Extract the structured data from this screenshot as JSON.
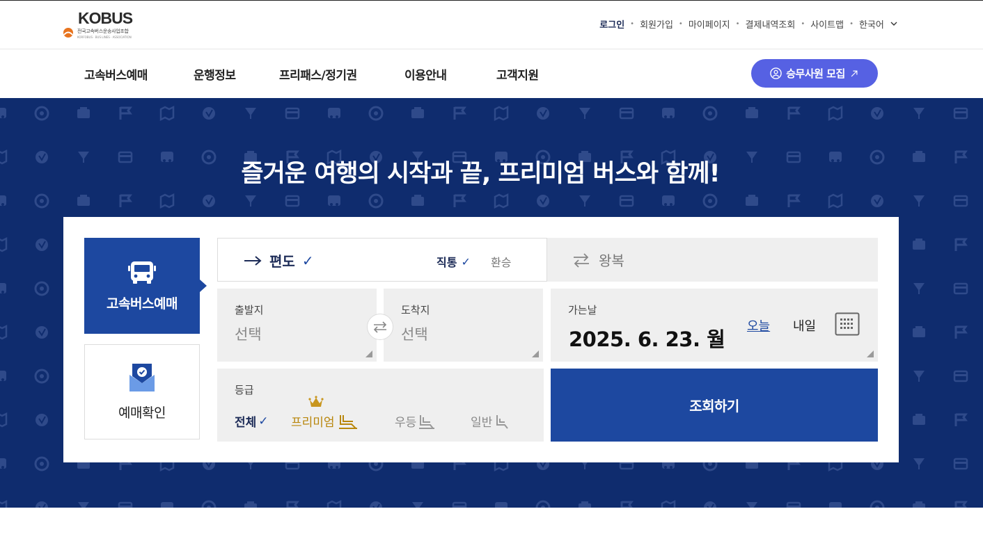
{
  "brand": {
    "logo_word": "KOBUS",
    "logo_sub": "전국고속버스운송사업조합",
    "logo_sub_en": "KORFOBUS · BUS LINES · ASSOCIATION",
    "accent_color": "#e8741f"
  },
  "util_nav": {
    "login": "로그인",
    "signup": "회원가입",
    "mypage": "마이페이지",
    "payments": "결제내역조회",
    "sitemap": "사이트맵",
    "language": "한국어"
  },
  "main_nav": {
    "items": [
      "고속버스예매",
      "운행정보",
      "프리패스/정기권",
      "이용안내",
      "고객지원"
    ],
    "recruit_button": "승무사원 모집",
    "recruit_color": "#5661e3"
  },
  "hero": {
    "title": "즐거운 여행의 시작과 끝, 프리미엄 버스와 함께!",
    "background": "#0f2c6e"
  },
  "booking": {
    "side_tabs": {
      "active": "고속버스예매",
      "inactive": "예매확인"
    },
    "trip_type": {
      "oneway": "편도",
      "direct": "직통",
      "transfer": "환승",
      "roundtrip": "왕복"
    },
    "depart": {
      "label": "출발지",
      "value": "선택"
    },
    "arrive": {
      "label": "도착지",
      "value": "선택"
    },
    "date": {
      "label": "가는날",
      "value": "2025. 6. 23. 월",
      "today": "오늘",
      "tomorrow": "내일"
    },
    "grade": {
      "label": "등급",
      "all": "전체",
      "premium": "프리미엄",
      "deluxe": "우등",
      "normal": "일반"
    },
    "search_button": "조회하기",
    "primary_color": "#1d48a0"
  }
}
